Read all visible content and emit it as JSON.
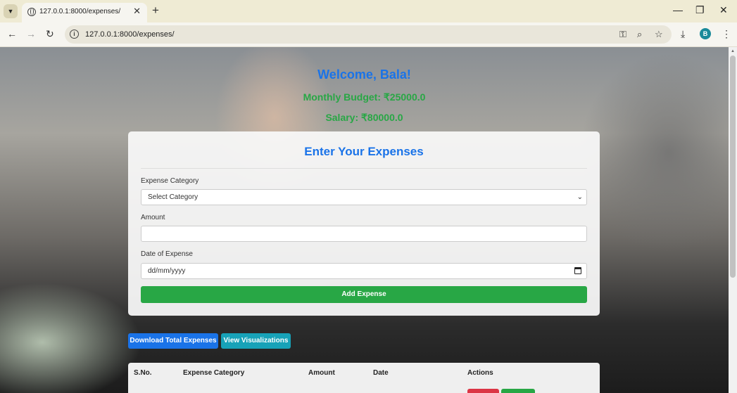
{
  "browser": {
    "tab_title": "127.0.0.1:8000/expenses/",
    "url": "127.0.0.1:8000/expenses/",
    "profile_initial": "B",
    "new_tab": "+",
    "tab_close": "✕"
  },
  "header": {
    "welcome": "Welcome, Bala!",
    "budget": "Monthly Budget: ₹25000.0",
    "salary": "Salary: ₹80000.0"
  },
  "form": {
    "title": "Enter Your Expenses",
    "category_label": "Expense Category",
    "category_value": "Select Category",
    "amount_label": "Amount",
    "amount_value": "",
    "date_label": "Date of Expense",
    "date_placeholder": "dd/mm/yyyy",
    "submit_label": "Add Expense"
  },
  "actions": {
    "download_label": "Download Total Expenses",
    "visualize_label": "View Visualizations"
  },
  "table": {
    "headers": [
      "S.No.",
      "Expense Category",
      "Amount",
      "Date",
      "Actions"
    ]
  },
  "colors": {
    "primary": "#1a73e8",
    "success": "#28a745",
    "info": "#17a2b8",
    "danger": "#dc3545"
  }
}
